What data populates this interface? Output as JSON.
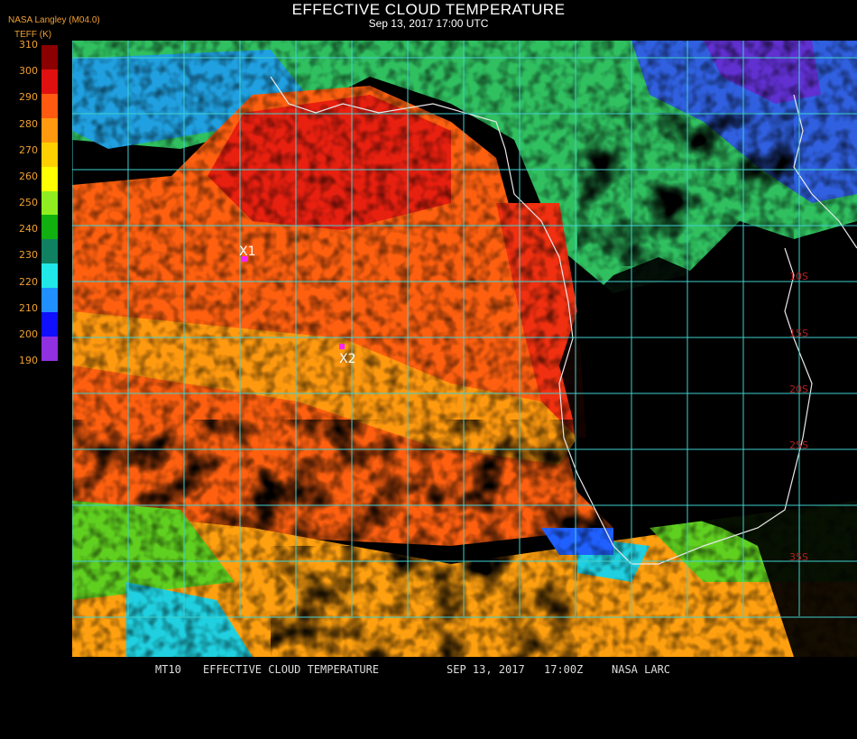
{
  "header": {
    "title": "EFFECTIVE CLOUD TEMPERATURE",
    "subtitle": "Sep 13, 2017 17:00 UTC",
    "organization": "NASA Langley (M04.0)",
    "unit": "TEFF (K)"
  },
  "legend": {
    "ticks": [
      "310",
      "300",
      "290",
      "280",
      "270",
      "260",
      "250",
      "240",
      "230",
      "220",
      "210",
      "200",
      "190"
    ],
    "colors": [
      "#8b0000",
      "#e01010",
      "#ff5a10",
      "#ff9a10",
      "#ffd000",
      "#ffff00",
      "#90ee20",
      "#10b010",
      "#108060",
      "#20e8e8",
      "#2090ff",
      "#1010ff",
      "#9030e0"
    ]
  },
  "map": {
    "grid_color": "#40d0d0",
    "markers": [
      {
        "label": "X1",
        "color": "#ff20ff"
      },
      {
        "label": "X2",
        "color": "#ff20ff"
      }
    ],
    "lat_labels": [
      "10S",
      "15S",
      "20S",
      "25S",
      "35S"
    ]
  },
  "footer": {
    "product": "MT10",
    "title": "EFFECTIVE CLOUD TEMPERATURE",
    "date": "SEP 13, 2017",
    "time": "17:00Z",
    "source": "NASA LARC"
  }
}
